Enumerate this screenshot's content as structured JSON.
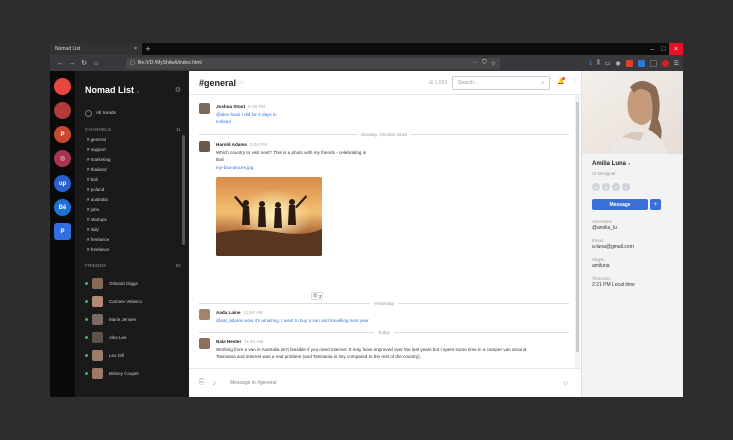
{
  "browser": {
    "tab_title": "Nomad List",
    "tab_close": "×",
    "new_tab": "+",
    "url": "file:///D:/MyShiteA/index.html",
    "url_dots": "···",
    "controls": {
      "min": "–",
      "max": "□",
      "close": "×"
    }
  },
  "colors": {
    "accent": "#3a6fd8",
    "online": "#47b35a",
    "sidebar_bg": "#1a1a1a",
    "rail_bg": "#0a0a0a"
  },
  "rail": [
    {
      "icon": "nomad-logo-icon",
      "label": "",
      "color": "#e8473e"
    },
    {
      "icon": "team-icon",
      "label": "",
      "color": "#b23a3a"
    },
    {
      "icon": "p-icon",
      "label": "P",
      "color": "#c9492f"
    },
    {
      "icon": "dribbble-icon",
      "label": "◎",
      "color": "#a8324f"
    },
    {
      "icon": "upwork-icon",
      "label": "up",
      "color": "#2b5fd1"
    },
    {
      "icon": "behance-icon",
      "label": "Bē",
      "color": "#1f6fd6"
    },
    {
      "icon": "pinterest-icon",
      "label": "P",
      "color": "#2f6fe0"
    }
  ],
  "sidebar": {
    "brand": "Nomad List",
    "brand_caret": "⌄",
    "all_threads": "All treads",
    "channels_label": "CHANNELS",
    "channels_count": "11",
    "channels": [
      "# general",
      "# support",
      "# marketing",
      "# thailand",
      "# bali",
      "# poland",
      "# australia",
      "# jobs",
      "# startups",
      "# italy",
      "# freelance",
      "# freelance"
    ],
    "friends_label": "FRIENDS",
    "friends_count": "82",
    "friends": [
      {
        "name": "Orlando Diggs",
        "color": "#8b6a55"
      },
      {
        "name": "Carmen Velasco",
        "color": "#b58a74"
      },
      {
        "name": "Marie Jensen",
        "color": "#7a6a66"
      },
      {
        "name": "Alex Lee",
        "color": "#5f5349"
      },
      {
        "name": "Leo Gill",
        "color": "#9c7e68"
      },
      {
        "name": "Britney Cooper",
        "color": "#a07866"
      }
    ]
  },
  "header": {
    "channel": "#general",
    "star": "☆",
    "member_icon": "⊞",
    "member_count": "1,093",
    "search_placeholder": "Search...",
    "search_icon": "⌕"
  },
  "messages": [
    {
      "name": "Joshua Stout",
      "time": "6:38 PM",
      "lines": [
        "@alex-hack I did for 6 days in",
        "Iceland"
      ],
      "link_lines": [
        0,
        1
      ],
      "avatar": "#7b6a5c"
    },
    {
      "name": "Harold Adams",
      "time": "5:02 PM",
      "lines": [
        "Which country to visit next? This is a photo with my friends - celebrating in",
        "Bali",
        "my-bsa-places.jpg"
      ],
      "link_lines": [
        2
      ],
      "avatar": "#6b5a4c"
    },
    {
      "name": "Aada Laine",
      "time": "11:54 AM",
      "lines": [
        "@sal_adams wow it's amazing. I want to buy a van and travelling next year"
      ],
      "link_lines": [
        0
      ],
      "avatar": "#a5846c"
    },
    {
      "name": "Nala Hester",
      "time": "11:54 AM",
      "lines": [
        "Working from a van in Australia isn't feasible if you need internet. It may have improved over the last years but I spent some time in a camper van around",
        "Tasmania and internet was a real problem (and Tasmania is tiny compared to the rest of the country)."
      ],
      "link_lines": [],
      "avatar": "#8e6e5c"
    },
    {
      "name": "Harold Adams",
      "time": "5:02 PM",
      "lines": [
        "Which country to visit next? This is a photo with my friends - celebrating in",
        "Bali",
        "my-bsa-places.jpg"
      ],
      "link_lines": [
        2
      ],
      "avatar": "#6b5a4c"
    }
  ],
  "dividers": {
    "d1": "Monday, October 22nd",
    "d2": "Yesterday",
    "d3": "Today"
  },
  "reaction": {
    "emoji": "😮",
    "count": "3"
  },
  "composer": {
    "placeholder": "Message in #general",
    "attach_icon": "📎",
    "mic_icon": "🎙",
    "emoji_icon": "☺"
  },
  "profile": {
    "name": "Amilia Luna",
    "online_dot": "●",
    "role": "UI Designer",
    "social": [
      "in",
      "◎",
      "✓",
      "f"
    ],
    "message_btn": "Message",
    "plus_btn": "+",
    "fields": [
      {
        "label": "Username",
        "value": "@amilia_lu"
      },
      {
        "label": "Email",
        "value": "a-luna@gmail.com"
      },
      {
        "label": "Skype",
        "value": "amiluna"
      },
      {
        "label": "Timezone",
        "value": "2:21 PM Local time"
      }
    ]
  }
}
